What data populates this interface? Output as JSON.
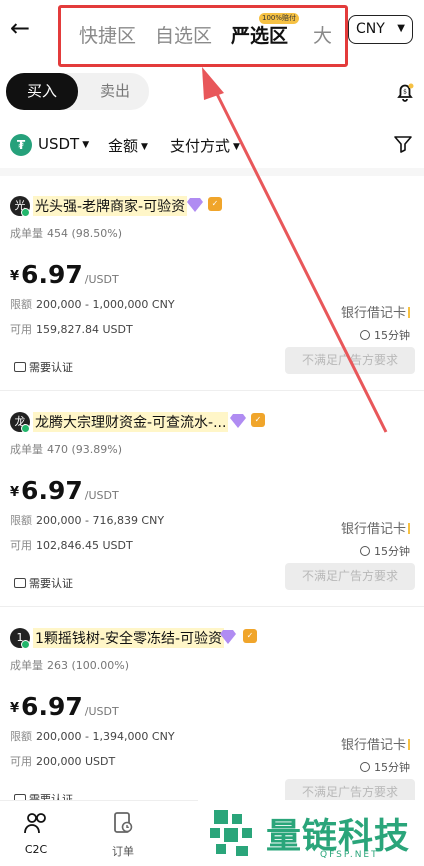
{
  "header": {
    "back_icon": "arrow-left-icon",
    "zones": [
      "快捷区",
      "自选区",
      "严选区",
      "大宗区"
    ],
    "zone_visible_partial": "大",
    "zone_badge": "100%赔付",
    "currency": "CNY",
    "highlight_color": "#e33b3b"
  },
  "trade_tabs": {
    "buy": "买入",
    "sell": "卖出"
  },
  "filters": {
    "coin": "USDT",
    "amount": "金额",
    "payment": "支付方式"
  },
  "ads": [
    {
      "avatar": "光",
      "merchant": "光头强-老牌商家-可验资",
      "stats_label": "成单量",
      "stats_value": "454 (98.50%)",
      "currency_symbol": "¥",
      "price": "6.97",
      "price_unit": "/USDT",
      "limit_label": "限额",
      "limit_value": "200,000 - 1,000,000 CNY",
      "avail_label": "可用",
      "avail_value": "159,827.84 USDT",
      "payment_method": "银行借记卡",
      "time": "15分钟",
      "kyc": "需要认证",
      "action": "不满足广告方要求"
    },
    {
      "avatar": "龙",
      "merchant": "龙腾大宗理财资金-可查流水-...",
      "stats_label": "成单量",
      "stats_value": "470 (93.89%)",
      "currency_symbol": "¥",
      "price": "6.97",
      "price_unit": "/USDT",
      "limit_label": "限额",
      "limit_value": "200,000 - 716,839 CNY",
      "avail_label": "可用",
      "avail_value": "102,846.45 USDT",
      "payment_method": "银行借记卡",
      "time": "15分钟",
      "kyc": "需要认证",
      "action": "不满足广告方要求"
    },
    {
      "avatar": "1",
      "merchant": "1颗摇钱树-安全零冻结-可验资",
      "stats_label": "成单量",
      "stats_value": "263 (100.00%)",
      "currency_symbol": "¥",
      "price": "6.97",
      "price_unit": "/USDT",
      "limit_label": "限额",
      "limit_value": "200,000 - 1,394,000 CNY",
      "avail_label": "可用",
      "avail_value": "200,000 USDT",
      "payment_method": "银行借记卡",
      "time": "15分钟",
      "kyc": "需要认证",
      "action": "不满足广告方要求"
    }
  ],
  "bottom_nav": {
    "c2c": "C2C",
    "orders": "订单"
  },
  "watermark": {
    "text": "量链科技",
    "sub": "QFSP.NET",
    "color": "#2aa57a"
  }
}
